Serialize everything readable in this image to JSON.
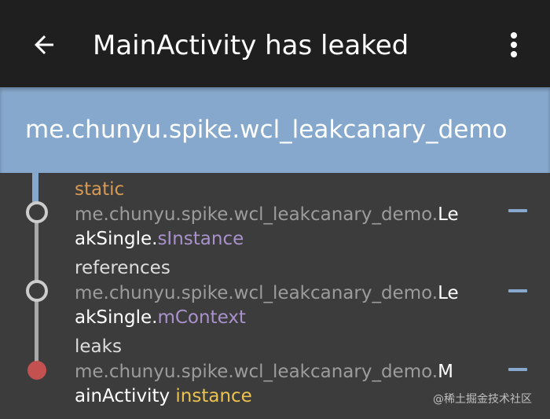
{
  "toolbar": {
    "title": "MainActivity has leaked",
    "back_icon": "arrow-back-icon",
    "overflow_icon": "more-vert-icon"
  },
  "root": {
    "label": "me.chunyu.spike.wcl_leakcanary_demo"
  },
  "trace": [
    {
      "type": "static",
      "line1_pkg": "me.chunyu.spike.wcl_leakcanary_demo.",
      "line1_cls": "Le",
      "line2_cls": "akSingle.",
      "line2_field": "sInstance",
      "toggle": "—"
    },
    {
      "type": "references",
      "line1_pkg": "me.chunyu.spike.wcl_leakcanary_demo.",
      "line1_cls": "Le",
      "line2_cls": "akSingle.",
      "line2_field": "mContext",
      "toggle": "—"
    },
    {
      "type": "leaks",
      "line1_pkg": "me.chunyu.spike.wcl_leakcanary_demo.",
      "line1_cls": "M",
      "line2_cls": "ainActivity ",
      "line2_field": "instance",
      "toggle": "—"
    }
  ],
  "watermark": "@稀土掘金技术社区",
  "colors": {
    "toolbar_bg": "#1f1f1f",
    "root_bg": "#86a8cc",
    "list_bg": "#3c3c3c",
    "static": "#d79a55",
    "field": "#a992cc",
    "instance": "#ebc34e",
    "leak_node": "#c2514f"
  }
}
